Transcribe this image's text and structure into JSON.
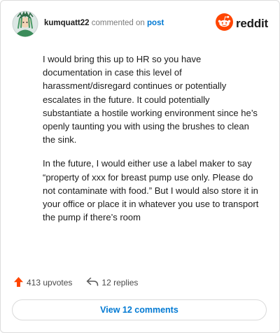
{
  "comment": {
    "username": "kumquatt22",
    "action_text": "commented on",
    "link_text": "post",
    "paragraphs": [
      "I would bring this up to HR so you have documentation in case this level of harassment/disregard continues or potentially escalates in the future. It could potentially substantiate a hostile working environment since he’s openly taunting you with using the brushes to clean the sink.",
      "In the future, I would either use a label maker to say “property of xxx for breast pump use only. Please do not contaminate with food.” But I would also store it in your office or place it in whatever you use to transport the pump if there’s room"
    ]
  },
  "brand": {
    "name": "reddit",
    "color": "#ff4500"
  },
  "stats": {
    "upvotes": "413 upvotes",
    "replies": "12 replies"
  },
  "view_button": "View 12 comments",
  "colors": {
    "accent": "#0079d3",
    "upvote": "#ff4500",
    "muted": "#7c7c7c"
  },
  "icons": {
    "avatar": "avatar-icon",
    "logo": "reddit-snoo-icon",
    "upvote": "upvote-arrow-icon",
    "reply": "reply-arrow-icon"
  }
}
